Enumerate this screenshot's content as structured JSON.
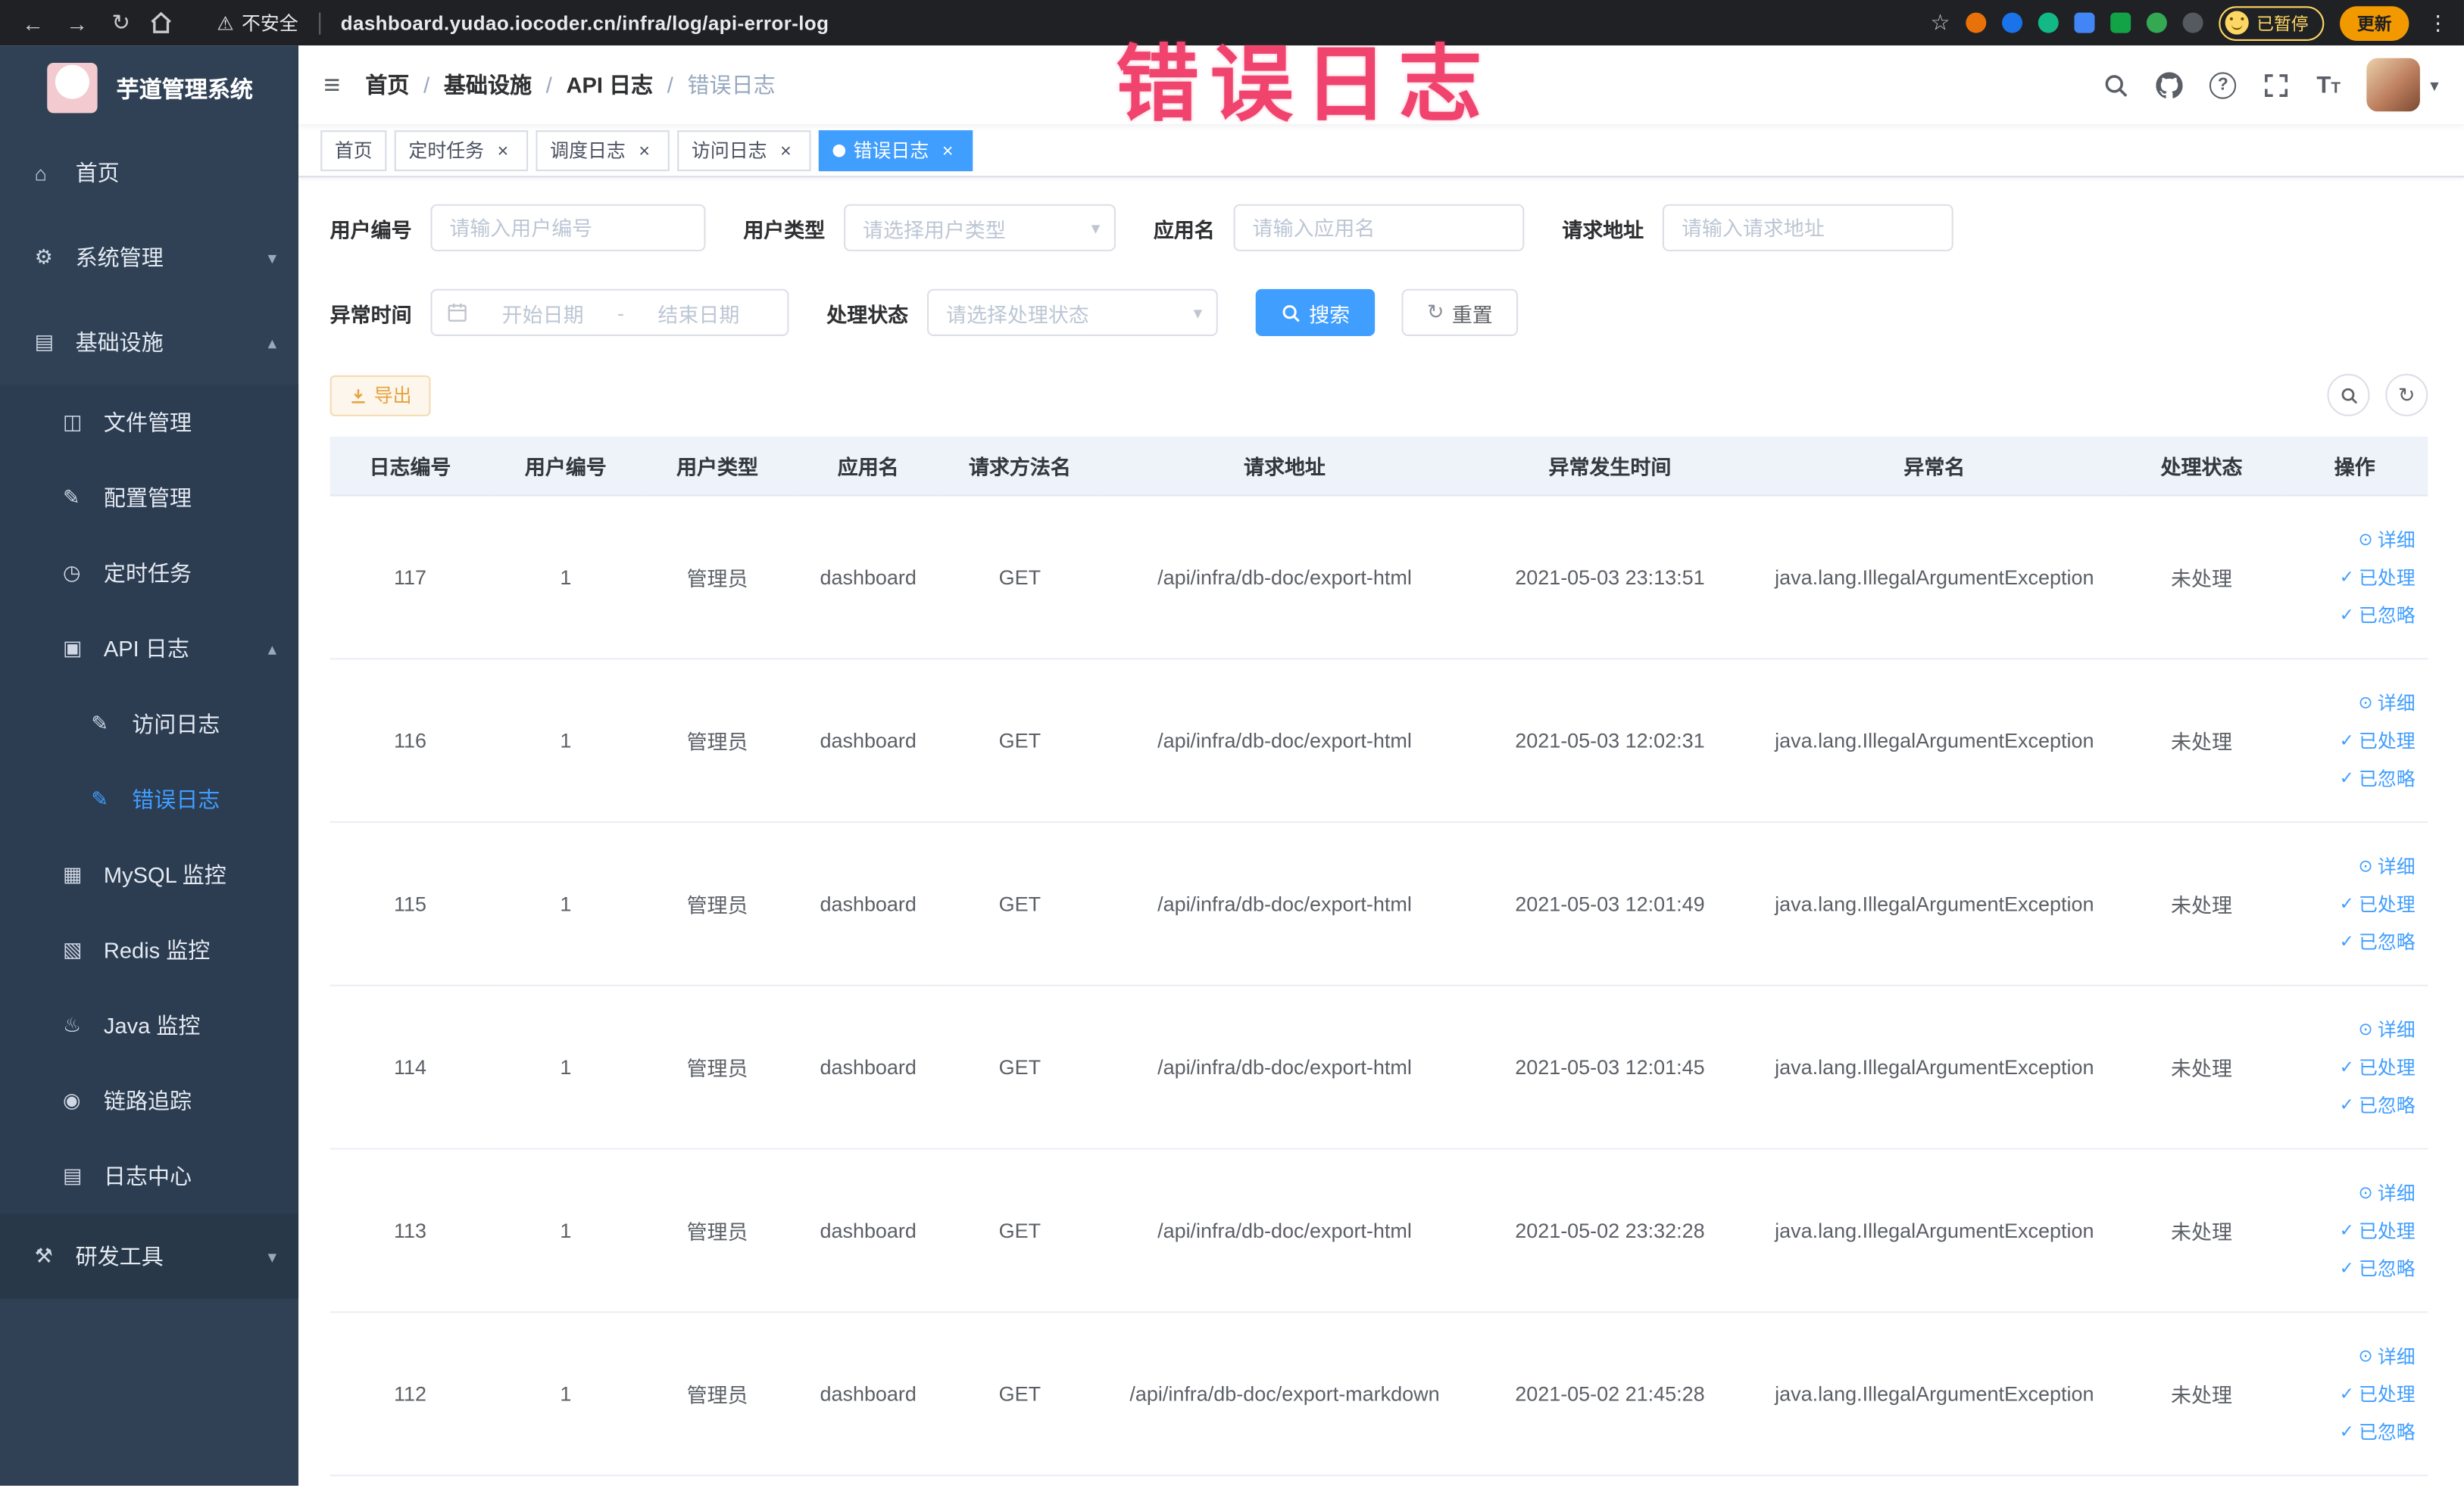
{
  "browser": {
    "security_warning": "不安全",
    "url": "dashboard.yudao.iocoder.cn/infra/log/api-error-log",
    "profile_badge": "已暂停",
    "update_button": "更新"
  },
  "overlay_annotation": "错误日志",
  "icons": {
    "back": "←",
    "forward": "→",
    "reload": "↻",
    "warning": "⚠",
    "star": "☆",
    "more": "⋮",
    "hamburger": "≡",
    "help": "?",
    "text_size": "T",
    "chevron_down": "▾",
    "chevron_up": "▴",
    "close": "×",
    "select_caret": "▾",
    "refresh": "↻",
    "detail": "⊙",
    "check": "✓"
  },
  "sidebar": {
    "logo_title": "芋道管理系统",
    "items": [
      {
        "label": "首页",
        "icon": "⌂"
      },
      {
        "label": "系统管理",
        "icon": "⚙"
      },
      {
        "label": "基础设施",
        "icon": "▤"
      },
      {
        "label": "文件管理",
        "icon": "◫"
      },
      {
        "label": "配置管理",
        "icon": "✎"
      },
      {
        "label": "定时任务",
        "icon": "◷"
      },
      {
        "label": "API 日志",
        "icon": "▣"
      },
      {
        "label": "访问日志",
        "icon": "✎"
      },
      {
        "label": "错误日志",
        "icon": "✎"
      },
      {
        "label": "MySQL 监控",
        "icon": "▦"
      },
      {
        "label": "Redis 监控",
        "icon": "▧"
      },
      {
        "label": "Java 监控",
        "icon": "♨"
      },
      {
        "label": "链路追踪",
        "icon": "◉"
      },
      {
        "label": "日志中心",
        "icon": "▤"
      },
      {
        "label": "研发工具",
        "icon": "⚒"
      }
    ]
  },
  "breadcrumb": {
    "separator": "/",
    "items": [
      "首页",
      "基础设施",
      "API 日志",
      "错误日志"
    ]
  },
  "tabs": [
    {
      "label": "首页"
    },
    {
      "label": "定时任务"
    },
    {
      "label": "调度日志"
    },
    {
      "label": "访问日志"
    },
    {
      "label": "错误日志"
    }
  ],
  "filters": {
    "user_id_label": "用户编号",
    "user_id_placeholder": "请输入用户编号",
    "user_type_label": "用户类型",
    "user_type_placeholder": "请选择用户类型",
    "app_name_label": "应用名",
    "app_name_placeholder": "请输入应用名",
    "request_url_label": "请求地址",
    "request_url_placeholder": "请输入请求地址",
    "exception_time_label": "异常时间",
    "date_start_placeholder": "开始日期",
    "date_separator": "-",
    "date_end_placeholder": "结束日期",
    "process_status_label": "处理状态",
    "process_status_placeholder": "请选择处理状态",
    "search_button": "搜索",
    "reset_button": "重置"
  },
  "toolbar": {
    "export_button": "导出"
  },
  "table": {
    "columns": [
      "日志编号",
      "用户编号",
      "用户类型",
      "应用名",
      "请求方法名",
      "请求地址",
      "异常发生时间",
      "异常名",
      "处理状态",
      "操作"
    ],
    "action_labels": {
      "detail": "详细",
      "processed": "已处理",
      "ignored": "已忽略"
    },
    "rows": [
      {
        "log_id": "117",
        "user_id": "1",
        "user_type": "管理员",
        "app_name": "dashboard",
        "method": "GET",
        "url": "/api/infra/db-doc/export-html",
        "time": "2021-05-03 23:13:51",
        "exception": "java.lang.IllegalArgumentException",
        "status": "未处理"
      },
      {
        "log_id": "116",
        "user_id": "1",
        "user_type": "管理员",
        "app_name": "dashboard",
        "method": "GET",
        "url": "/api/infra/db-doc/export-html",
        "time": "2021-05-03 12:02:31",
        "exception": "java.lang.IllegalArgumentException",
        "status": "未处理"
      },
      {
        "log_id": "115",
        "user_id": "1",
        "user_type": "管理员",
        "app_name": "dashboard",
        "method": "GET",
        "url": "/api/infra/db-doc/export-html",
        "time": "2021-05-03 12:01:49",
        "exception": "java.lang.IllegalArgumentException",
        "status": "未处理"
      },
      {
        "log_id": "114",
        "user_id": "1",
        "user_type": "管理员",
        "app_name": "dashboard",
        "method": "GET",
        "url": "/api/infra/db-doc/export-html",
        "time": "2021-05-03 12:01:45",
        "exception": "java.lang.IllegalArgumentException",
        "status": "未处理"
      },
      {
        "log_id": "113",
        "user_id": "1",
        "user_type": "管理员",
        "app_name": "dashboard",
        "method": "GET",
        "url": "/api/infra/db-doc/export-html",
        "time": "2021-05-02 23:32:28",
        "exception": "java.lang.IllegalArgumentException",
        "status": "未处理"
      },
      {
        "log_id": "112",
        "user_id": "1",
        "user_type": "管理员",
        "app_name": "dashboard",
        "method": "GET",
        "url": "/api/infra/db-doc/export-markdown",
        "time": "2021-05-02 21:45:28",
        "exception": "java.lang.IllegalArgumentException",
        "status": "未处理"
      }
    ]
  },
  "colors": {
    "primary": "#409eff",
    "sidebar_bg": "#304156",
    "warning_accent": "#e6a23c",
    "annotation": "#f0436e"
  }
}
